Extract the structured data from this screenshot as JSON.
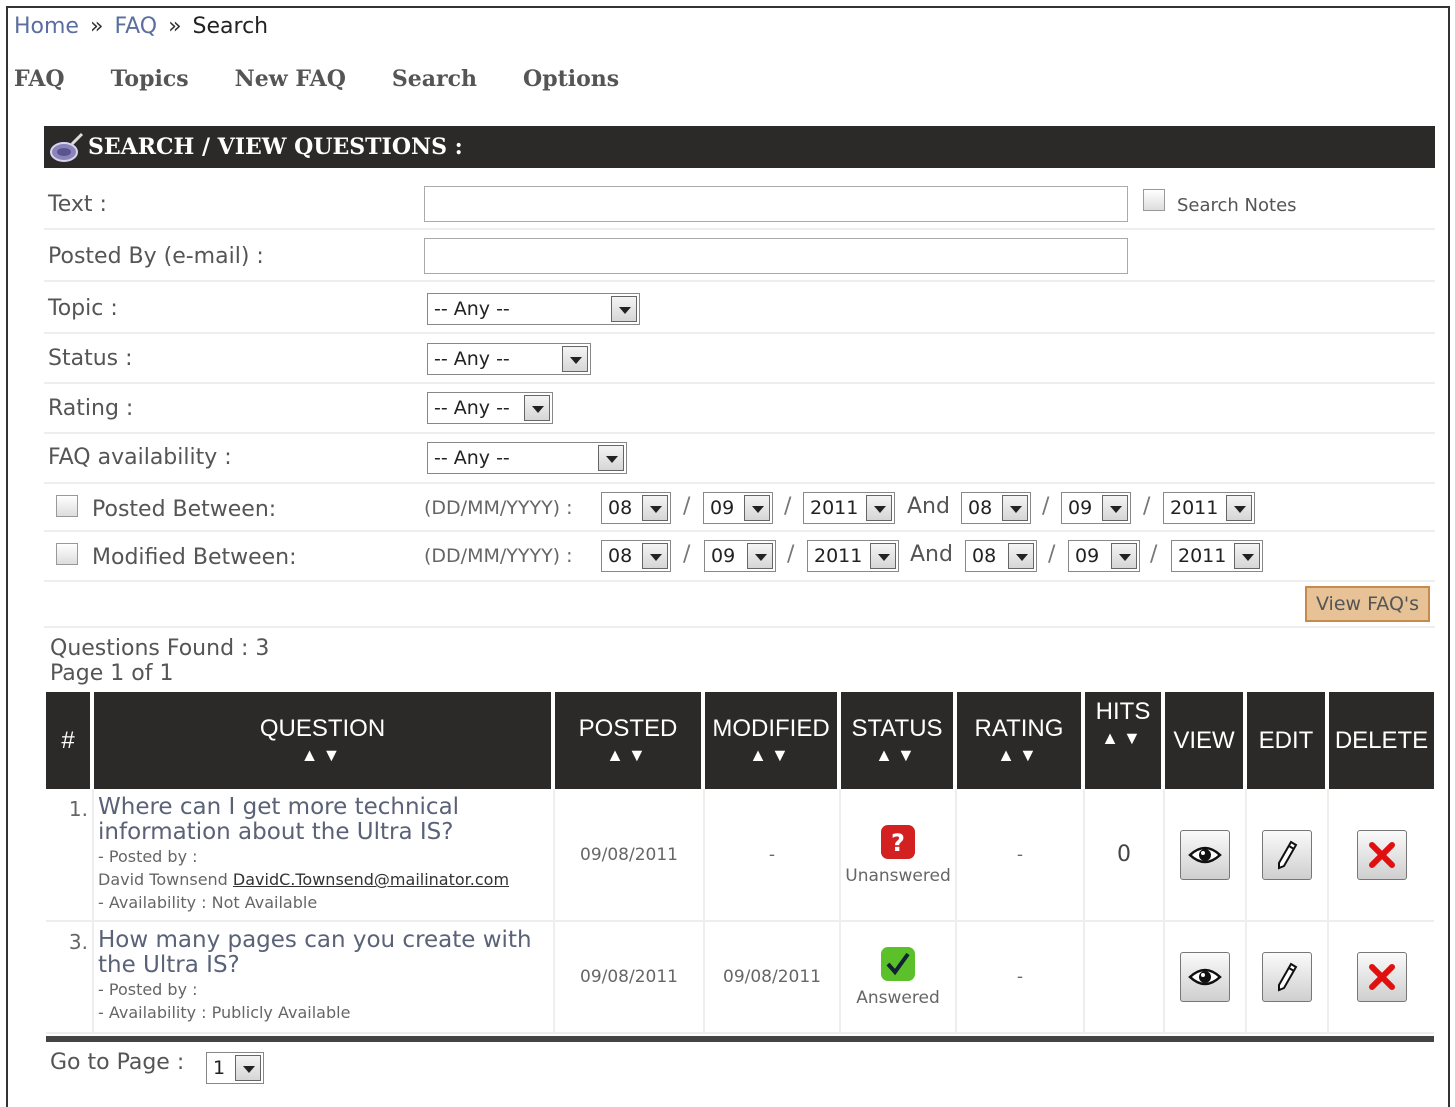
{
  "breadcrumb": {
    "home": "Home",
    "faq": "FAQ",
    "current": "Search",
    "separator": "»"
  },
  "nav": {
    "items": [
      "FAQ",
      "Topics",
      "New FAQ",
      "Search",
      "Options"
    ]
  },
  "panel": {
    "title": "SEARCH / VIEW QUESTIONS :"
  },
  "form": {
    "text_label": "Text :",
    "text_value": "",
    "search_notes_label": "Search Notes",
    "posted_by_label": "Posted By (e-mail) :",
    "posted_by_value": "",
    "topic_label": "Topic :",
    "topic_value": "-- Any --",
    "status_label": "Status :",
    "status_value": "-- Any --",
    "rating_label": "Rating :",
    "rating_value": "-- Any --",
    "availability_label": "FAQ availability :",
    "availability_value": "-- Any --",
    "posted_between_label": "Posted Between:",
    "modified_between_label": "Modified Between:",
    "date_format": "(DD/MM/YYYY) :",
    "and_label": "And",
    "slash": "/",
    "posted_from": {
      "dd": "08",
      "mm": "09",
      "yyyy": "2011"
    },
    "posted_to": {
      "dd": "08",
      "mm": "09",
      "yyyy": "2011"
    },
    "modified_from": {
      "dd": "08",
      "mm": "09",
      "yyyy": "2011"
    },
    "modified_to": {
      "dd": "08",
      "mm": "09",
      "yyyy": "2011"
    },
    "view_button": "View FAQ's"
  },
  "results": {
    "found": "Questions Found : 3",
    "page": "Page 1 of 1",
    "columns": {
      "num": "#",
      "question": "QUESTION",
      "posted": "POSTED",
      "modified": "MODIFIED",
      "status": "STATUS",
      "rating": "RATING",
      "hits": "HITS",
      "view": "VIEW",
      "edit": "EDIT",
      "delete": "DELETE"
    },
    "sort_arrows": "▲▼",
    "rows": [
      {
        "num": "1.",
        "question": "Where can I get more technical information about the Ultra IS?",
        "posted_by_label": "- Posted by :",
        "author": "David Townsend",
        "email": "DavidC.Townsend@mailinator.com",
        "availability": "- Availability : Not Available",
        "posted": "09/08/2011",
        "modified": "-",
        "status": "Unanswered",
        "rating": "-",
        "hits": "0"
      },
      {
        "num": "3.",
        "question": "How many pages can you create with the Ultra IS?",
        "posted_by_label": "- Posted by :",
        "availability": "- Availability : Publicly Available",
        "posted": "09/08/2011",
        "modified": "09/08/2011",
        "status": "Answered",
        "rating": "-",
        "hits": ""
      }
    ]
  },
  "pager": {
    "label": "Go to Page :",
    "value": "1"
  },
  "colors": {
    "header_bg": "#2c2a28",
    "view_button_bg": "#e6c296",
    "unanswered": "#d32020",
    "answered": "#5cc02a"
  }
}
